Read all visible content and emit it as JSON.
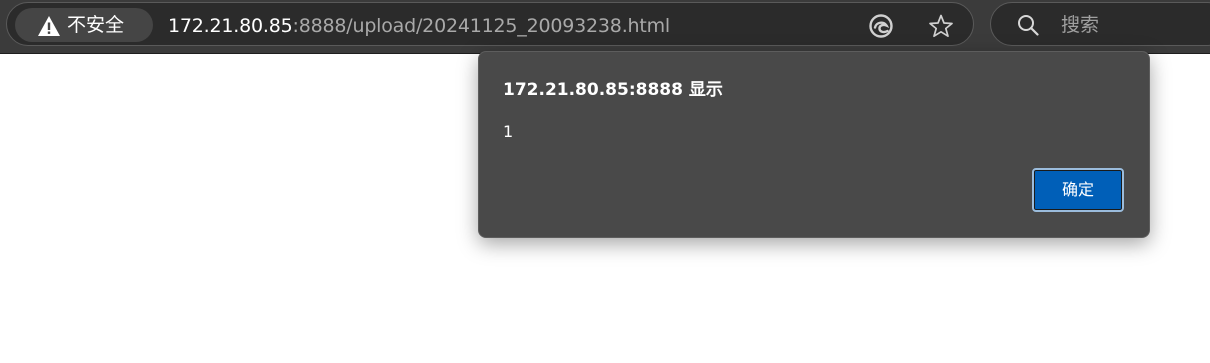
{
  "browser": {
    "security_label": "不安全",
    "url_host": "172.21.80.85",
    "url_rest": ":8888/upload/20241125_20093238.html",
    "icons": {
      "security": "warning-triangle-icon",
      "edge": "edge-copilot-icon",
      "favorite": "star-icon",
      "search": "search-icon"
    },
    "search_placeholder": "搜索"
  },
  "dialog": {
    "title": "172.21.80.85:8888 显示",
    "message": "1",
    "ok_label": "确定",
    "ok_color": "#005fb8"
  }
}
